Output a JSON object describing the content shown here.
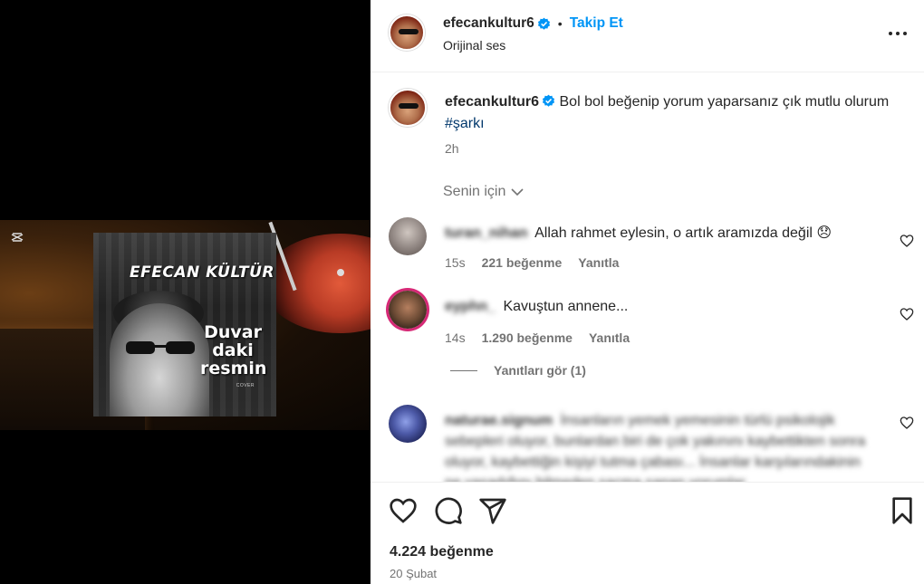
{
  "media": {
    "cover_artist": "EFECAN KÜLTÜR",
    "cover_title_lines": [
      "Duvar",
      "daki",
      "resmin"
    ],
    "cover_tag": "COVER",
    "capcut_icon": "capcut-icon"
  },
  "header": {
    "username": "efecankultur6",
    "separator": "•",
    "follow_label": "Takip Et",
    "audio_label": "Orijinal ses",
    "more_icon": "more-horizontal-icon"
  },
  "caption": {
    "username": "efecankultur6",
    "text": "Bol bol beğenip yorum yaparsanız çık mutlu olurum",
    "hashtag": "#şarkı",
    "time": "2h"
  },
  "sort": {
    "label": "Senin için"
  },
  "comments": [
    {
      "username": "turan_nihan",
      "text": "Allah rahmet eylesin, o artık aramızda değil 😞",
      "time": "15s",
      "likes": "221 beğenme",
      "reply": "Yanıtla"
    },
    {
      "username": "eyphn_",
      "text": "Kavuştun annene...",
      "time": "14s",
      "likes": "1.290 beğenme",
      "reply": "Yanıtla",
      "view_replies": "Yanıtları gör (1)"
    },
    {
      "username": "naturae.signum",
      "text": "İnsanların yemek yemesinin türlü psikolojik sebepleri oluyor, bunlardan biri de çok yakınını kaybettikten sonra oluyor, kaybettiğin kişiyi tutma çabası... İnsanlar karşılarındakinin ne yaşadığını bilmeden saçma sapan yorumlar"
    }
  ],
  "actions": {
    "like_icon": "heart-icon",
    "comment_icon": "comment-icon",
    "share_icon": "share-icon",
    "save_icon": "bookmark-icon",
    "likes_count": "4.224 beğenme",
    "date": "20 Şubat"
  },
  "colors": {
    "accent_blue": "#0095f6",
    "hashtag": "#00376b",
    "muted": "#737373",
    "text": "#262626"
  }
}
